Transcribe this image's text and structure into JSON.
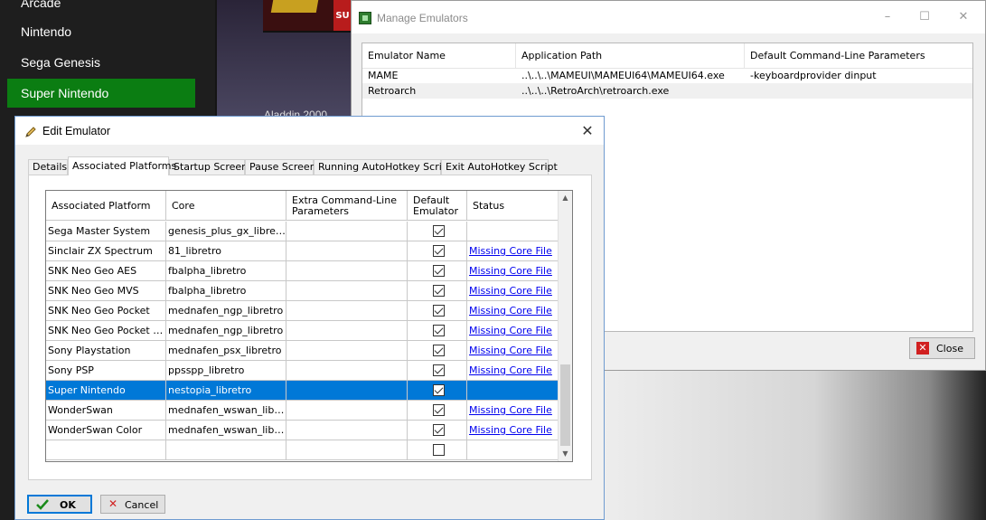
{
  "launcher": {
    "platforms": [
      {
        "label": "Arcade",
        "selected": false
      },
      {
        "label": "Nintendo",
        "selected": false
      },
      {
        "label": "Sega Genesis",
        "selected": false
      },
      {
        "label": "Super Nintendo",
        "selected": true
      }
    ],
    "game_title": "Aladdin 2000",
    "selected_color": "#0b7d12"
  },
  "manage_window": {
    "title": "Manage Emulators",
    "columns": [
      "Emulator Name",
      "Application Path",
      "Default Command-Line Parameters"
    ],
    "rows": [
      {
        "name": "MAME",
        "path": "..\\..\\..\\MAMEUI\\MAMEUI64\\MAMEUI64.exe",
        "params": "-keyboardprovider dinput"
      },
      {
        "name": "Retroarch",
        "path": "..\\..\\..\\RetroArch\\retroarch.exe",
        "params": ""
      }
    ],
    "close_label": "Close"
  },
  "edit_dialog": {
    "title": "Edit Emulator",
    "tabs": [
      {
        "label": "Details",
        "active": false
      },
      {
        "label": "Associated Platforms",
        "active": true
      },
      {
        "label": "Startup Screen",
        "active": false
      },
      {
        "label": "Pause Screen",
        "active": false
      },
      {
        "label": "Running AutoHotkey Script",
        "active": false
      },
      {
        "label": "Exit AutoHotkey Script",
        "active": false
      }
    ],
    "grid": {
      "columns": [
        "Associated Platform",
        "Core",
        "Extra Command-Line Parameters",
        "Default Emulator",
        "Status"
      ],
      "rows": [
        {
          "platform": "Sega Master System",
          "core": "genesis_plus_gx_libretro",
          "extra": "",
          "default": true,
          "status": ""
        },
        {
          "platform": "Sinclair ZX Spectrum",
          "core": "81_libretro",
          "extra": "",
          "default": true,
          "status": "Missing Core File"
        },
        {
          "platform": "SNK Neo Geo AES",
          "core": "fbalpha_libretro",
          "extra": "",
          "default": true,
          "status": "Missing Core File"
        },
        {
          "platform": "SNK Neo Geo MVS",
          "core": "fbalpha_libretro",
          "extra": "",
          "default": true,
          "status": "Missing Core File"
        },
        {
          "platform": "SNK Neo Geo Pocket",
          "core": "mednafen_ngp_libretro",
          "extra": "",
          "default": true,
          "status": "Missing Core File"
        },
        {
          "platform": "SNK Neo Geo Pocket C...",
          "core": "mednafen_ngp_libretro",
          "extra": "",
          "default": true,
          "status": "Missing Core File"
        },
        {
          "platform": "Sony Playstation",
          "core": "mednafen_psx_libretro",
          "extra": "",
          "default": true,
          "status": "Missing Core File"
        },
        {
          "platform": "Sony PSP",
          "core": "ppsspp_libretro",
          "extra": "",
          "default": true,
          "status": "Missing Core File"
        },
        {
          "platform": "Super Nintendo",
          "core": "nestopia_libretro",
          "extra": "",
          "default": true,
          "status": "",
          "selected": true
        },
        {
          "platform": "WonderSwan",
          "core": "mednafen_wswan_libr...",
          "extra": "",
          "default": true,
          "status": "Missing Core File"
        },
        {
          "platform": "WonderSwan Color",
          "core": "mednafen_wswan_libr...",
          "extra": "",
          "default": true,
          "status": "Missing Core File"
        },
        {
          "platform": "",
          "core": "",
          "extra": "",
          "default": false,
          "status": ""
        }
      ]
    },
    "ok_label": "OK",
    "cancel_label": "Cancel",
    "selection_color": "#0078d7"
  }
}
